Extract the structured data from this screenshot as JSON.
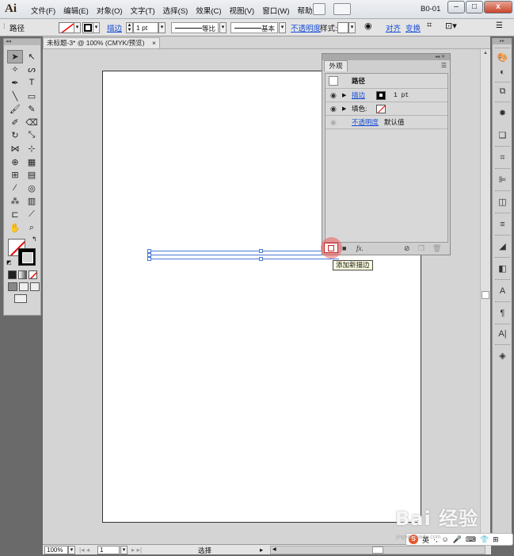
{
  "app": {
    "logo": "Ai",
    "workspace": "B0-01",
    "menus": [
      "文件(F)",
      "编辑(E)",
      "对象(O)",
      "文字(T)",
      "选择(S)",
      "效果(C)",
      "视图(V)",
      "窗口(W)",
      "帮助(H)"
    ],
    "window_buttons": [
      "–",
      "□",
      "x"
    ]
  },
  "control_bar": {
    "object_type": "路径",
    "stroke_label": "描边",
    "stroke_weight": "1 pt",
    "profile": "等比",
    "brush": "基本",
    "opacity_label": "不透明度",
    "style_label": "样式:",
    "align_label": "对齐",
    "transform_label": "变换"
  },
  "document": {
    "tab_title": "未标题-3* @ 100% (CMYK/预览)",
    "tab_close": "×"
  },
  "appearance_panel": {
    "tab_label": "外观",
    "header": "路径",
    "rows": [
      {
        "label": "描边",
        "value": "1 pt",
        "link": true
      },
      {
        "label": "填色:",
        "value": "",
        "link": false
      },
      {
        "label": "不透明度",
        "value": "默认值",
        "link": true
      }
    ],
    "fx_label": "fx."
  },
  "tooltip": "添加新描边",
  "status_bar": {
    "zoom": "100%",
    "artboard": "1",
    "status_text": "选择"
  },
  "watermark": {
    "brand": "Bai 经验",
    "sub": "jingyan.baidu.com"
  },
  "ime_bar": {
    "label": "英"
  },
  "colors": {
    "link": "#1a4fd6",
    "highlight": "#eb5c5c",
    "selection": "#4a78d8",
    "tooltip_bg": "#ffffe1"
  }
}
